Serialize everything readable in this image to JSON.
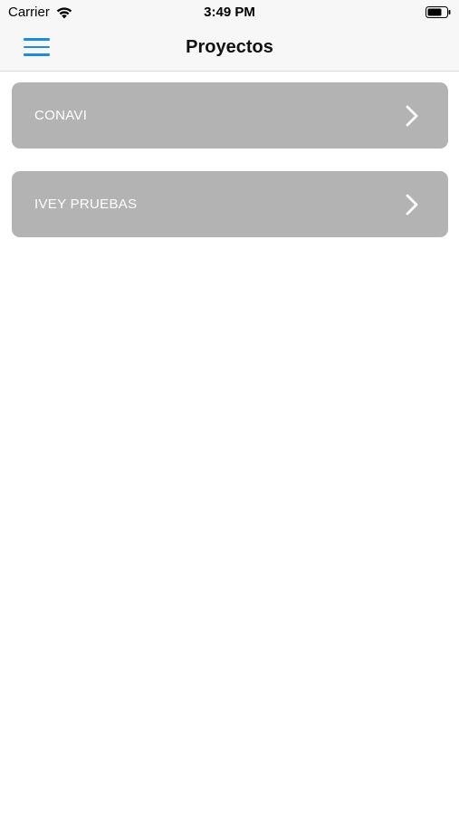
{
  "status_bar": {
    "carrier": "Carrier",
    "time": "3:49 PM"
  },
  "nav": {
    "title": "Proyectos",
    "menu_icon": "hamburger-menu-icon",
    "accent_color": "#1a8ce8"
  },
  "projects": [
    {
      "name": "CONAVI"
    },
    {
      "name": "IVEY PRUEBAS"
    }
  ],
  "colors": {
    "card_background": "#b3b3b3",
    "card_text": "#ffffff",
    "bar_background": "#f7f7f7"
  }
}
